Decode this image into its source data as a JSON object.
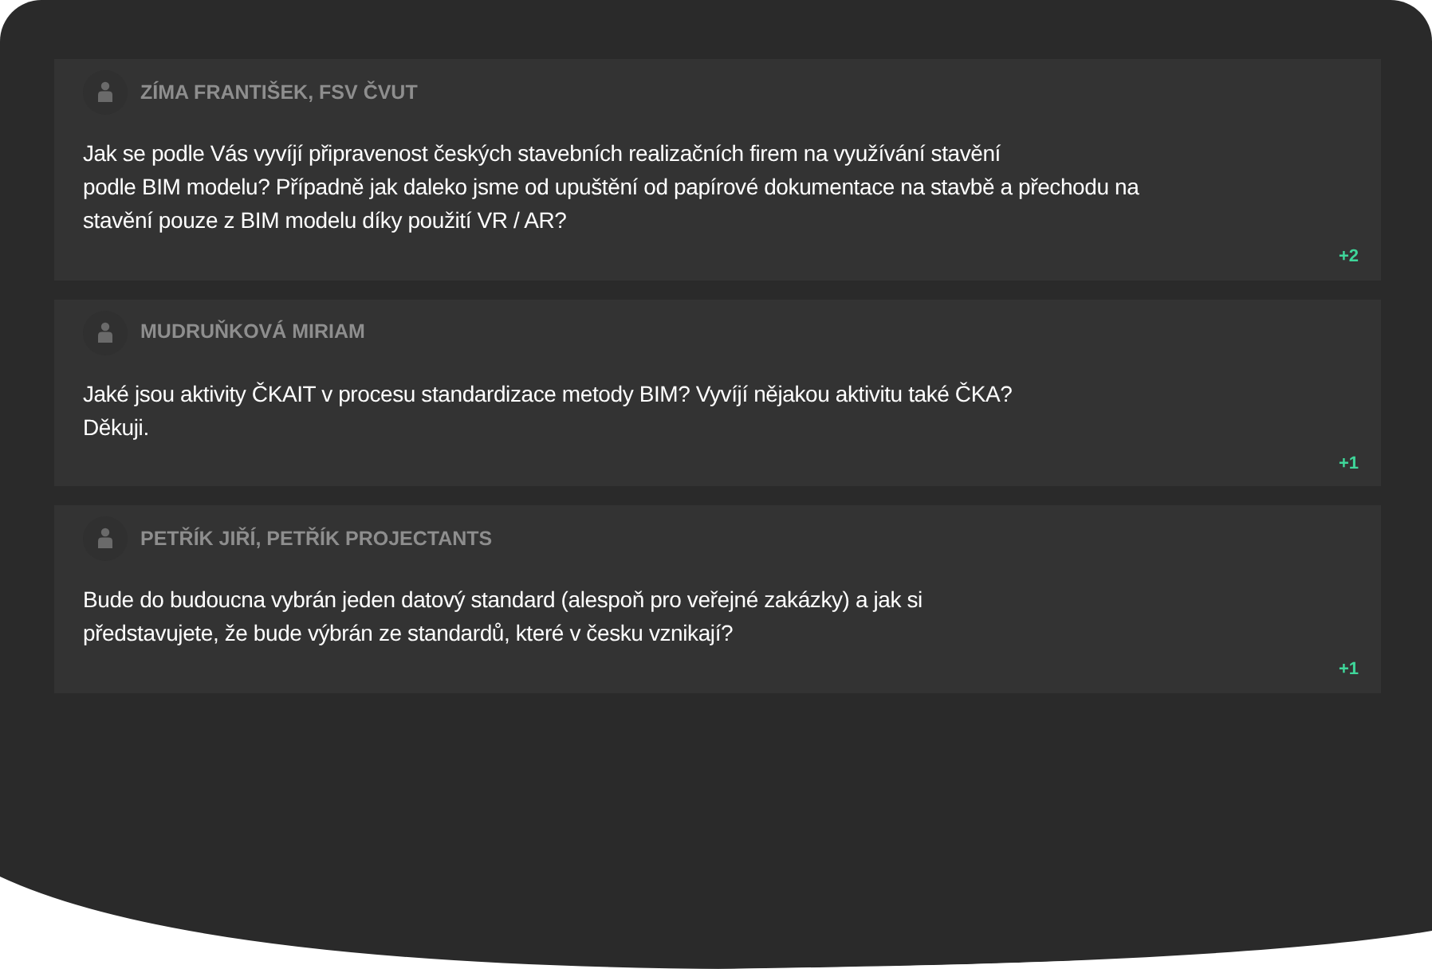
{
  "questions": [
    {
      "author": "ZÍMA FRANTIŠEK, FSV ČVUT",
      "lines": [
        "Jak se podle Vás vyvíjí připravenost českých stavebních realizačních firem na využívání stavění",
        "podle BIM modelu? Případně jak daleko jsme od upuštění od papírové dokumentace na stavbě a přechodu na",
        "stavění pouze z BIM modelu díky použití VR / AR?"
      ],
      "votes": "+2"
    },
    {
      "author": "MUDRUŇKOVÁ MIRIAM",
      "lines": [
        "Jaké jsou aktivity ČKAIT v procesu standardizace metody BIM? Vyvíjí nějakou aktivitu také ČKA?",
        "Děkuji."
      ],
      "votes": "+1"
    },
    {
      "author": "PETŘÍK JIŘÍ, PETŘÍK PROJECTANTS",
      "lines": [
        "Bude do budoucna vybrán jeden datový standard (alespoň pro veřejné zakázky) a jak si",
        "představujete, že bude výbrán ze standardů, které v česku vznikají?"
      ],
      "votes": "+1"
    }
  ]
}
